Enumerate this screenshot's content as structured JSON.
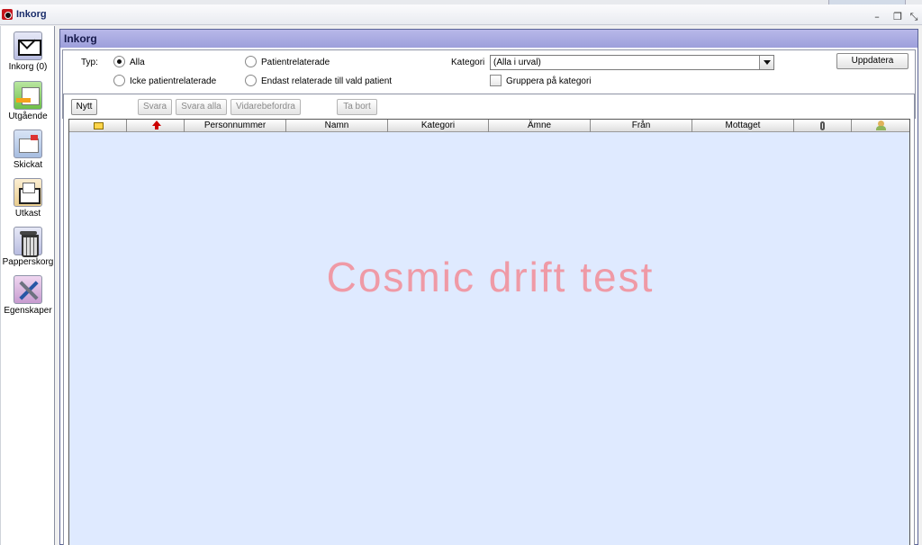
{
  "window": {
    "title": "Inkorg",
    "minimize_glyph": "–",
    "restore_glyph": "❐",
    "close_glyph": "⤡"
  },
  "sidebar": {
    "items": [
      {
        "label": "Inkorg (0)",
        "icon": "inbox-icon"
      },
      {
        "label": "Utgående",
        "icon": "outbox-icon"
      },
      {
        "label": "Skickat",
        "icon": "sent-icon"
      },
      {
        "label": "Utkast",
        "icon": "draft-icon"
      },
      {
        "label": "Papperskorg",
        "icon": "trash-icon"
      },
      {
        "label": "Egenskaper",
        "icon": "properties-icon"
      }
    ]
  },
  "panel": {
    "title": "Inkorg"
  },
  "filters": {
    "type_label": "Typ:",
    "type_options": {
      "all": "Alla",
      "non_patient": "Icke patientrelaterade",
      "patient": "Patientrelaterade",
      "selected_patient": "Endast relaterade till vald patient"
    },
    "selected_type": "all",
    "category_label": "Kategori",
    "category_value": "(Alla i urval)",
    "group_by_category_label": "Gruppera på kategori",
    "group_by_category_checked": false,
    "update_button": "Uppdatera"
  },
  "toolbar": {
    "new": "Nytt",
    "reply": "Svara",
    "reply_all": "Svara alla",
    "forward": "Vidarebefordra",
    "delete": "Ta bort"
  },
  "table": {
    "columns": [
      "Personnummer",
      "Namn",
      "Kategori",
      "Ämne",
      "Från",
      "Mottaget"
    ],
    "icon_columns": [
      "envelope-icon",
      "priority-arrow-icon",
      "attachment-icon",
      "person-icon"
    ],
    "rows": []
  },
  "watermark": "Cosmic drift test",
  "colors": {
    "header_bg": "#a9abe2",
    "grid_bg": "#dfeaff",
    "watermark": "#ef9aa6"
  }
}
